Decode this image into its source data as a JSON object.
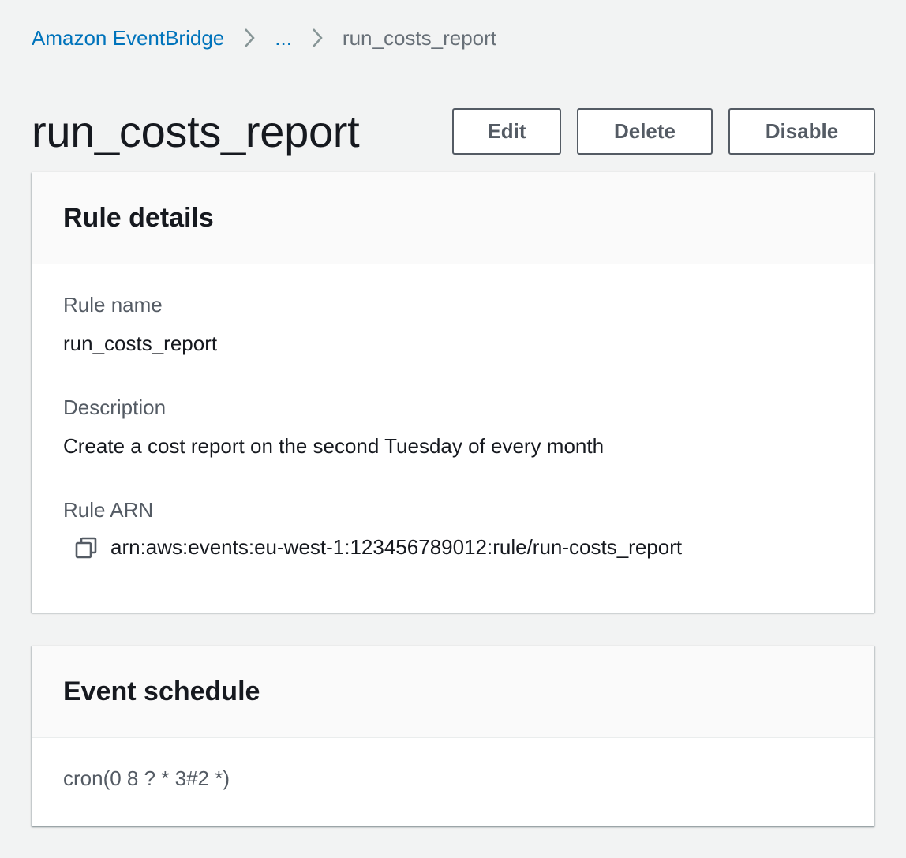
{
  "breadcrumb": {
    "root": "Amazon EventBridge",
    "ellipsis": "...",
    "current": "run_costs_report"
  },
  "page": {
    "title": "run_costs_report"
  },
  "actions": {
    "edit": "Edit",
    "delete": "Delete",
    "disable": "Disable"
  },
  "rule_details": {
    "heading": "Rule details",
    "name_label": "Rule name",
    "name_value": "run_costs_report",
    "description_label": "Description",
    "description_value": "Create a cost report on the second Tuesday of every month",
    "arn_label": "Rule ARN",
    "arn_value": "arn:aws:events:eu-west-1:123456789012:rule/run-costs_report",
    "arn_icon": "copy-icon"
  },
  "event_schedule": {
    "heading": "Event schedule",
    "value": "cron(0 8 ? * 3#2 *)"
  },
  "colors": {
    "link": "#0073bb",
    "background": "#f2f3f3",
    "text": "#16191f",
    "secondary_text": "#545b64"
  }
}
